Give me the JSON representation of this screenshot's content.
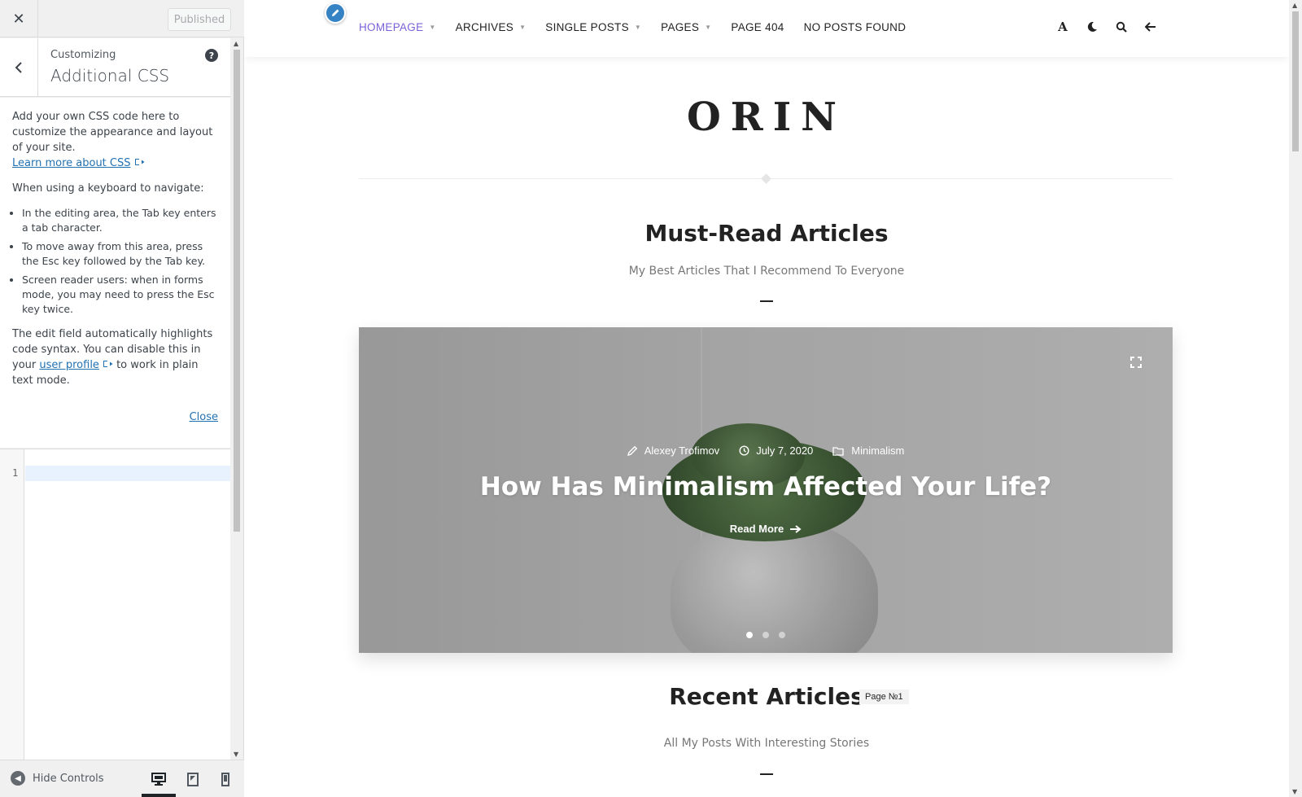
{
  "sidebar": {
    "close_label": "✕",
    "publish_label": "Published",
    "breadcrumb": "Customizing",
    "section_title": "Additional CSS",
    "help_label": "?",
    "intro_text": "Add your own CSS code here to customize the appearance and layout of your site.",
    "learn_more_link": "Learn more about CSS",
    "keyboard_heading": "When using a keyboard to navigate:",
    "keyboard_tips": [
      "In the editing area, the Tab key enters a tab character.",
      "To move away from this area, press the Esc key followed by the Tab key.",
      "Screen reader users: when in forms mode, you may need to press the Esc key twice."
    ],
    "highlight_text_before": "The edit field automatically highlights code syntax. You can disable this in your",
    "user_profile_link": "user profile",
    "highlight_text_after": "to work in plain text mode.",
    "close_link": "Close",
    "editor_line_number": "1",
    "hide_controls_label": "Hide Controls"
  },
  "preview": {
    "nav": [
      {
        "label": "HOMEPAGE",
        "dropdown": true
      },
      {
        "label": "ARCHIVES",
        "dropdown": true
      },
      {
        "label": "SINGLE POSTS",
        "dropdown": true
      },
      {
        "label": "PAGES",
        "dropdown": true
      },
      {
        "label": "PAGE 404",
        "dropdown": false
      },
      {
        "label": "NO POSTS FOUND",
        "dropdown": false
      }
    ],
    "font_toggle_label": "A",
    "logo": "ORIN",
    "must_read": {
      "title": "Must-Read Articles",
      "subtitle": "My Best Articles That I Recommend To Everyone"
    },
    "slide": {
      "author": "Alexey Trofimov",
      "date": "July 7, 2020",
      "category": "Minimalism",
      "title": "How Has Minimalism Affected Your Life?",
      "read_more": "Read More"
    },
    "recent": {
      "title": "Recent Articles",
      "page_badge": "Page №1",
      "subtitle": "All My Posts With Interesting Stories"
    }
  },
  "colors": {
    "accent": "#7b61d9",
    "link": "#2271b1",
    "edit_shortcut": "#3582c4"
  }
}
